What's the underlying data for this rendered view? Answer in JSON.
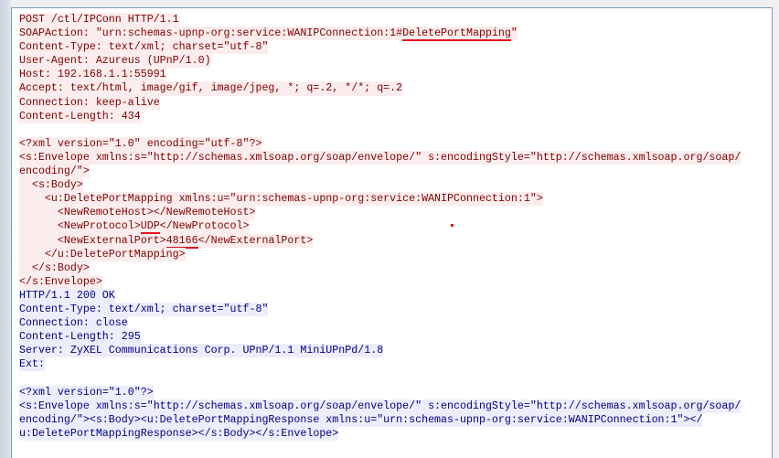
{
  "stream": {
    "client_color": "#7f0000",
    "client_bg": "#fbeded",
    "server_color": "#00007f",
    "server_bg": "#ededfb",
    "highlight_color": "#e0141e",
    "lines": [
      {
        "dir": "client",
        "segs": [
          {
            "t": "POST /ctl/IPConn HTTP/1.1"
          }
        ]
      },
      {
        "dir": "client",
        "segs": [
          {
            "t": "SOAPAction: \"urn:schemas-upnp-org:service:WANIPConnection:1#"
          },
          {
            "t": "DeletePortMapping",
            "mark": true
          },
          {
            "t": "\""
          }
        ]
      },
      {
        "dir": "client",
        "segs": [
          {
            "t": "Content-Type: text/xml; charset=\"utf-8\""
          }
        ]
      },
      {
        "dir": "client",
        "segs": [
          {
            "t": "User-Agent: Azureus (UPnP/1.0)"
          }
        ]
      },
      {
        "dir": "client",
        "segs": [
          {
            "t": "Host: 192.168.1.1:55991"
          }
        ]
      },
      {
        "dir": "client",
        "segs": [
          {
            "t": "Accept: text/html, image/gif, image/jpeg, *; q=.2, */*; q=.2"
          }
        ]
      },
      {
        "dir": "client",
        "segs": [
          {
            "t": "Connection: keep-alive"
          }
        ]
      },
      {
        "dir": "client",
        "segs": [
          {
            "t": "Content-Length: 434"
          }
        ]
      },
      {
        "dir": "blank",
        "segs": [
          {
            "t": ""
          }
        ]
      },
      {
        "dir": "client",
        "segs": [
          {
            "t": "<?xml version=\"1.0\" encoding=\"utf-8\"?>"
          }
        ]
      },
      {
        "dir": "client",
        "segs": [
          {
            "t": "<s:Envelope xmlns:s=\"http://schemas.xmlsoap.org/soap/envelope/\" s:encodingStyle=\"http://schemas.xmlsoap.org/soap/"
          }
        ]
      },
      {
        "dir": "client",
        "segs": [
          {
            "t": "encoding/\">"
          }
        ]
      },
      {
        "dir": "client",
        "segs": [
          {
            "t": "  <s:Body>"
          }
        ]
      },
      {
        "dir": "client",
        "segs": [
          {
            "t": "    <u:DeletePortMapping xmlns:u=\"urn:schemas-upnp-org:service:WANIPConnection:1\">"
          }
        ]
      },
      {
        "dir": "client",
        "segs": [
          {
            "t": "      <NewRemoteHost></NewRemoteHost>"
          }
        ]
      },
      {
        "dir": "client",
        "segs": [
          {
            "t": "      <NewProtocol>"
          },
          {
            "t": "UDP",
            "mark": true
          },
          {
            "t": "</NewProtocol>"
          }
        ]
      },
      {
        "dir": "client",
        "segs": [
          {
            "t": "      <NewExternalPort>"
          },
          {
            "t": "48166",
            "mark": true
          },
          {
            "t": "</NewExternalPort>"
          }
        ]
      },
      {
        "dir": "client",
        "segs": [
          {
            "t": "    </u:DeletePortMapping>"
          }
        ]
      },
      {
        "dir": "client",
        "segs": [
          {
            "t": "  </s:Body>"
          }
        ]
      },
      {
        "dir": "client",
        "segs": [
          {
            "t": "</s:Envelope>"
          }
        ]
      },
      {
        "dir": "server",
        "segs": [
          {
            "t": "HTTP/1.1 200 OK"
          }
        ]
      },
      {
        "dir": "server",
        "segs": [
          {
            "t": "Content-Type: text/xml; charset=\"utf-8\""
          }
        ]
      },
      {
        "dir": "server",
        "segs": [
          {
            "t": "Connection: close"
          }
        ]
      },
      {
        "dir": "server",
        "segs": [
          {
            "t": "Content-Length: 295"
          }
        ]
      },
      {
        "dir": "server",
        "segs": [
          {
            "t": "Server: ZyXEL Communications Corp. UPnP/1.1 MiniUPnPd/1.8"
          }
        ]
      },
      {
        "dir": "server",
        "segs": [
          {
            "t": "Ext:"
          }
        ]
      },
      {
        "dir": "blank",
        "segs": [
          {
            "t": ""
          }
        ]
      },
      {
        "dir": "server",
        "segs": [
          {
            "t": "<?xml version=\"1.0\"?>"
          }
        ]
      },
      {
        "dir": "server",
        "segs": [
          {
            "t": "<s:Envelope xmlns:s=\"http://schemas.xmlsoap.org/soap/envelope/\" s:encodingStyle=\"http://schemas.xmlsoap.org/soap/"
          }
        ]
      },
      {
        "dir": "server",
        "segs": [
          {
            "t": "encoding/\"><s:Body><u:DeletePortMappingResponse xmlns:u=\"urn:schemas-upnp-org:service:WANIPConnection:1\"></"
          }
        ]
      },
      {
        "dir": "server",
        "segs": [
          {
            "t": "u:DeletePortMappingResponse></s:Body></s:Envelope>"
          }
        ]
      }
    ]
  }
}
